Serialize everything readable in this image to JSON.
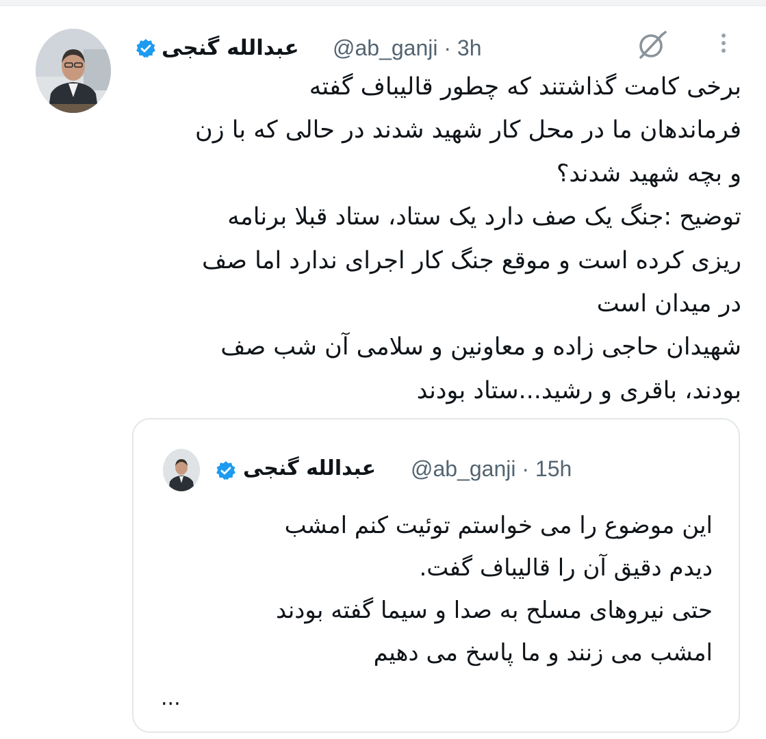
{
  "author": {
    "name": "عبدالله گنجی",
    "handle": "@ab_ganji · 3h",
    "verified_color": "#1d9bf0"
  },
  "tweet": {
    "lines": [
      "برخی کامت گذاشتند که چطور قالیباف گفته",
      "فرماندهان ما در محل کار شهید شدند در حالی که با زن",
      "و بچه شهید شدند؟",
      "توضیح :جنگ یک صف دارد یک ستاد، ستاد قبلا برنامه",
      "ریزی کرده است و موقع جنگ کار اجرای ندارد اما صف",
      "در میدان است",
      "شهیدان حاجی زاده و معاونین و سلامی آن شب صف",
      "بودند، باقری و رشید...ستاد بودند"
    ]
  },
  "quoted": {
    "name": "عبدالله گنجی",
    "handle": "@ab_ganji · 15h",
    "lines": [
      "این موضوع را می خواستم توئیت کنم امشب",
      "دیدم دقیق آن را قالیباف گفت.",
      "حتی نیروهای مسلح به صدا و سیما گفته بودند",
      "امشب می زنند و ما پاسخ می دهیم"
    ],
    "truncated": "..."
  },
  "icons": {
    "grok": "grok-icon",
    "more": "more-options-icon",
    "verified": "verified-badge-icon"
  }
}
